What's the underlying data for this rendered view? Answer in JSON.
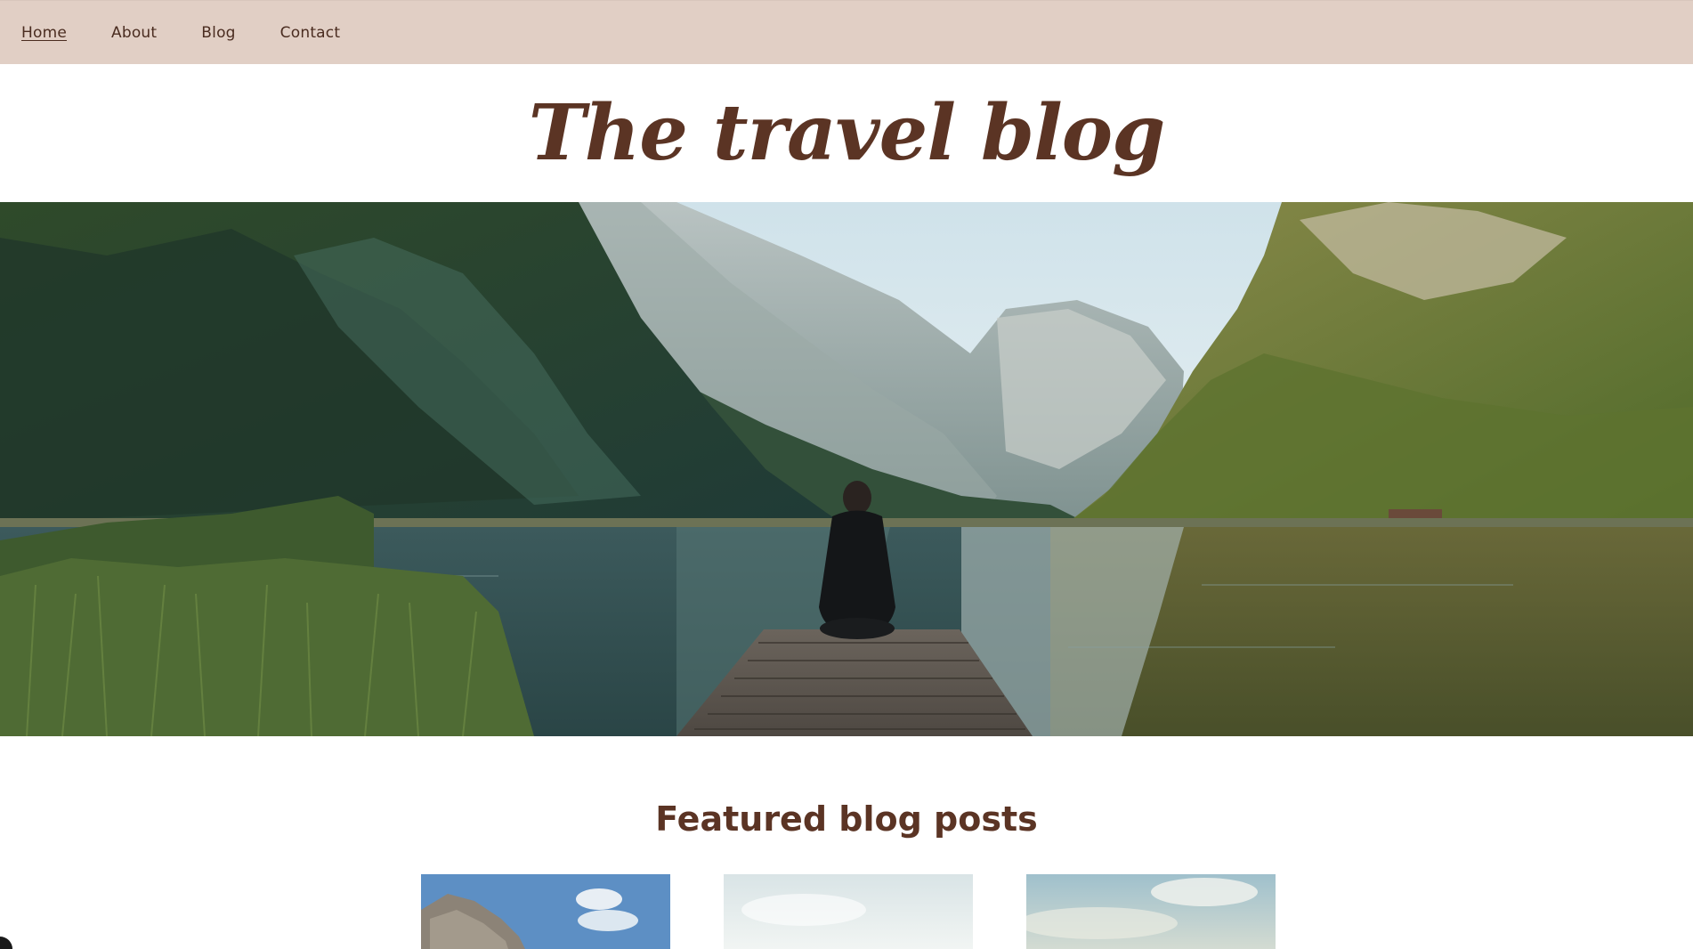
{
  "nav": {
    "items": [
      {
        "label": "Home",
        "active": true
      },
      {
        "label": "About",
        "active": false
      },
      {
        "label": "Blog",
        "active": false
      },
      {
        "label": "Contact",
        "active": false
      }
    ]
  },
  "site": {
    "title": "The travel blog"
  },
  "featured": {
    "heading": "Featured blog posts"
  },
  "colors": {
    "nav_background": "#e1cfc5",
    "brand_brown": "#5b3424",
    "nav_text": "#4a2c20"
  }
}
